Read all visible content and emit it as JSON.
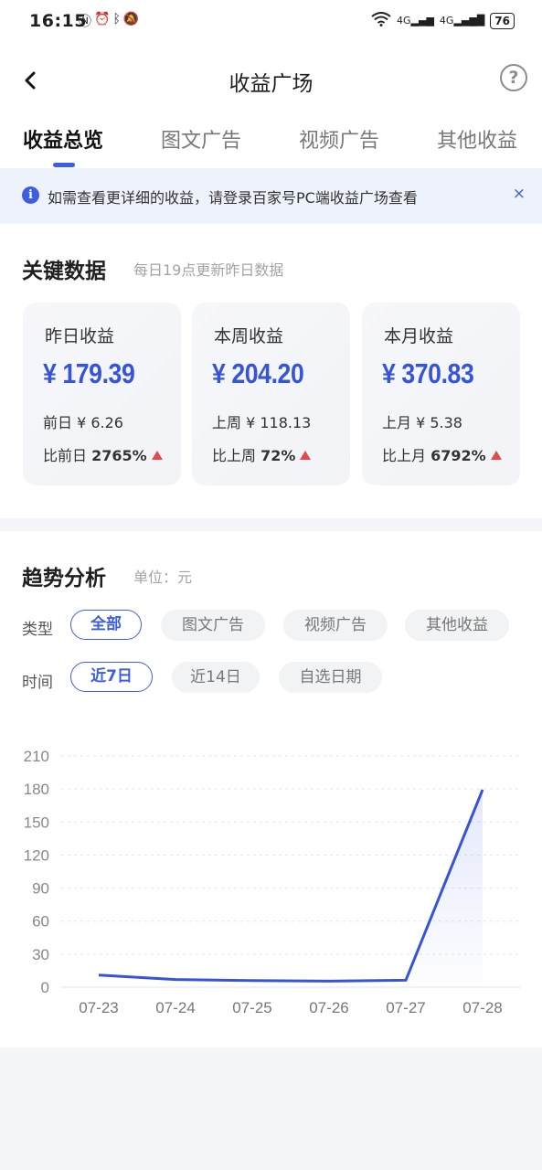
{
  "status_bar": {
    "time": "16:15",
    "battery": "76",
    "signal1": "4G",
    "signal2": "4G"
  },
  "header": {
    "title": "收益广场",
    "help": "?"
  },
  "tabs": [
    "收益总览",
    "图文广告",
    "视频广告",
    "其他收益"
  ],
  "notice": {
    "text": "如需查看更详细的收益，请登录百家号PC端收益广场查看",
    "info": "i",
    "close": "×"
  },
  "key_data": {
    "title": "关键数据",
    "subtitle": "每日19点更新昨日数据",
    "cards": [
      {
        "title": "昨日收益",
        "amount": "¥ 179.39",
        "prev": "前日 ¥ 6.26",
        "cmp_label": "比前日",
        "cmp_value": "2765%"
      },
      {
        "title": "本周收益",
        "amount": "¥ 204.20",
        "prev": "上周 ¥ 118.13",
        "cmp_label": "比上周",
        "cmp_value": "72%"
      },
      {
        "title": "本月收益",
        "amount": "¥ 370.83",
        "prev": "上月 ¥ 5.38",
        "cmp_label": "比上月",
        "cmp_value": "6792%"
      }
    ]
  },
  "trend": {
    "title": "趋势分析",
    "unit": "单位：元",
    "type_label": "类型",
    "type_options": [
      "全部",
      "图文广告",
      "视频广告",
      "其他收益"
    ],
    "type_selected": "全部",
    "time_label": "时间",
    "time_options": [
      "近7日",
      "近14日",
      "自选日期"
    ],
    "time_selected": "近7日"
  },
  "colors": {
    "accent": "#3d5ee0",
    "up": "#e54a4a"
  },
  "chart_data": {
    "type": "area",
    "categories": [
      "07-23",
      "07-24",
      "07-25",
      "07-26",
      "07-27",
      "07-28"
    ],
    "series": [
      {
        "values": [
          11,
          7,
          6,
          5.5,
          6.3,
          179.39
        ]
      }
    ],
    "yticks": [
      0,
      30,
      60,
      90,
      120,
      150,
      180,
      210
    ],
    "ylim": [
      0,
      210
    ],
    "grid": true
  }
}
